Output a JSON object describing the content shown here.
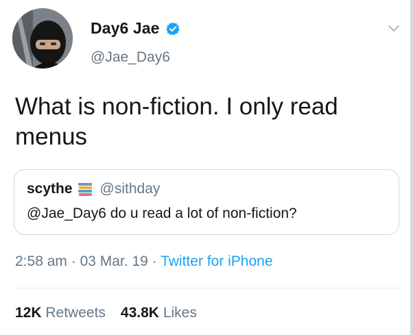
{
  "author": {
    "display_name": "Day6 Jae",
    "handle": "@Jae_Day6",
    "verified_icon": "verified-badge-icon"
  },
  "tweet": {
    "text": "What is non-fiction. I only read menus"
  },
  "quoted_tweet": {
    "display_name": "scythe",
    "emoji_icon": "books-icon",
    "handle": "@sithday",
    "text": "@Jae_Day6 do u read a lot of non-fiction?"
  },
  "meta": {
    "time": "2:58 am",
    "separator1": " · ",
    "date": "03 Mar. 19",
    "separator2": " · ",
    "source": "Twitter for iPhone"
  },
  "stats": {
    "retweets_count": "12K",
    "retweets_label": "Retweets",
    "likes_count": "43.8K",
    "likes_label": "Likes"
  },
  "colors": {
    "accent": "#1da1f2",
    "secondary_text": "#657786",
    "primary_text": "#14171a",
    "border": "#ccd6dd"
  }
}
